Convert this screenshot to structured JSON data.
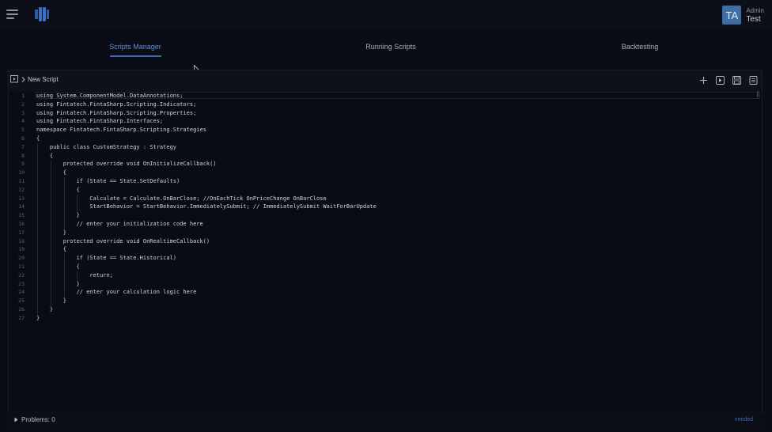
{
  "header": {
    "user": {
      "initials": "TA",
      "role": "Admin",
      "name": "Test"
    }
  },
  "tabs": [
    {
      "label": "Scripts Manager",
      "active": true
    },
    {
      "label": "Running Scripts",
      "active": false
    },
    {
      "label": "Backtesting",
      "active": false
    }
  ],
  "editor": {
    "script_name": "New Script",
    "toolbar_icons": [
      "plus-icon",
      "run-icon",
      "save-icon",
      "document-icon"
    ],
    "lines": [
      {
        "n": "1",
        "text": "using System.ComponentModel.DataAnnotations;"
      },
      {
        "n": "2",
        "text": "using Fintatech.FintaSharp.Scripting.Indicators;"
      },
      {
        "n": "3",
        "text": "using Fintatech.FintaSharp.Scripting.Properties;"
      },
      {
        "n": "4",
        "text": "using Fintatech.FintaSharp.Interfaces;"
      },
      {
        "n": "5",
        "text": "namespace Fintatech.FintaSharp.Scripting.Strategies"
      },
      {
        "n": "6",
        "text": "{"
      },
      {
        "n": "7",
        "text": "    public class CustomStrategy : Strategy"
      },
      {
        "n": "8",
        "text": "    {"
      },
      {
        "n": "9",
        "text": "        protected override void OnInitializeCallback()"
      },
      {
        "n": "10",
        "text": "        {"
      },
      {
        "n": "11",
        "text": "            if (State == State.SetDefaults)"
      },
      {
        "n": "12",
        "text": "            {"
      },
      {
        "n": "13",
        "text": "                Calculate = Calculate.OnBarClose; //OnEachTick OnPriceChange OnBarClose"
      },
      {
        "n": "14",
        "text": "                StartBehavior = StartBehavior.ImmediatelySubmit; // ImmediatelySubmit WaitForBarUpdate"
      },
      {
        "n": "15",
        "text": "            }"
      },
      {
        "n": "16",
        "text": "            // enter your initialization code here"
      },
      {
        "n": "17",
        "text": "        }"
      },
      {
        "n": "18",
        "text": "        protected override void OnRealtimeCallback()"
      },
      {
        "n": "19",
        "text": "        {"
      },
      {
        "n": "20",
        "text": "            if (State == State.Historical)"
      },
      {
        "n": "21",
        "text": "            {"
      },
      {
        "n": "22",
        "text": "                return;"
      },
      {
        "n": "23",
        "text": "            }"
      },
      {
        "n": "24",
        "text": "            // enter your calculation logic here"
      },
      {
        "n": "25",
        "text": "        }"
      },
      {
        "n": "26",
        "text": "    }"
      },
      {
        "n": "27",
        "text": "}"
      }
    ]
  },
  "status": {
    "problems_label": "Problems: 0",
    "right_text": "needed"
  },
  "colors": {
    "accent": "#5b8fd4",
    "background": "#0a0d16"
  }
}
